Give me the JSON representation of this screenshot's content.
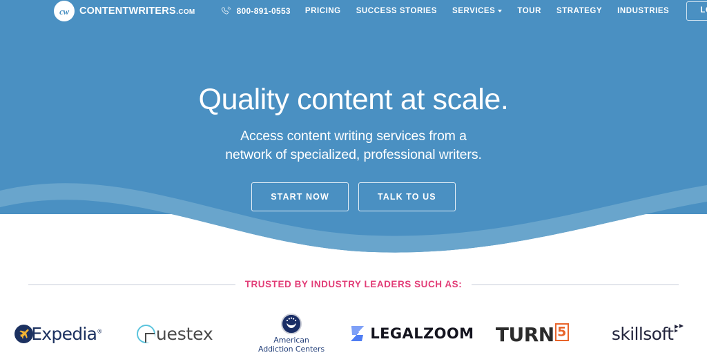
{
  "colors": {
    "hero_blue": "#4a90c2",
    "hero_wave_light": "#69a5cc",
    "accent_pink": "#e23d77",
    "page_bg": "#ffffff",
    "rule_gray": "#e3e6ec"
  },
  "header": {
    "brand": {
      "mark_text": "cw",
      "name": "CONTENTWRITERS",
      "tld": ".COM"
    },
    "phone": {
      "icon": "phone-icon",
      "number": "800-891-0553"
    },
    "nav_items": [
      {
        "label": "PRICING",
        "has_caret": false
      },
      {
        "label": "SUCCESS STORIES",
        "has_caret": false
      },
      {
        "label": "SERVICES",
        "has_caret": true
      },
      {
        "label": "TOUR",
        "has_caret": false
      },
      {
        "label": "STRATEGY",
        "has_caret": false
      },
      {
        "label": "INDUSTRIES",
        "has_caret": false
      }
    ],
    "login_label": "LOGIN"
  },
  "hero": {
    "title": "Quality content at scale.",
    "subtitle_line1": "Access content writing services from a",
    "subtitle_line2": "network of specialized, professional writers.",
    "cta_primary": "START NOW",
    "cta_secondary": "TALK TO US"
  },
  "trusted": {
    "label": "TRUSTED BY INDUSTRY LEADERS SUCH AS:",
    "logos": [
      {
        "name": "Expedia",
        "word": "Expedia",
        "tm": "®"
      },
      {
        "name": "Questex",
        "word": "uestex"
      },
      {
        "name": "American Addiction Centers",
        "line1": "American",
        "line2": "Addiction Centers"
      },
      {
        "name": "LegalZoom",
        "word": "LEGALZOOM"
      },
      {
        "name": "TURN5",
        "word": "TURN",
        "digit": "5"
      },
      {
        "name": "Skillsoft",
        "word": "skillsoft"
      }
    ]
  }
}
